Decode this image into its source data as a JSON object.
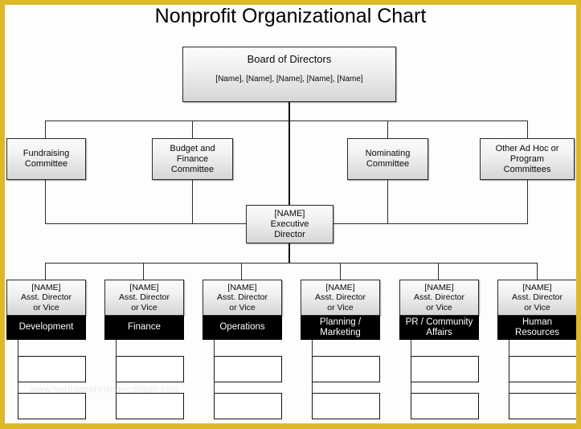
{
  "page": {
    "title": "Nonprofit Organizational Chart",
    "watermark": "www.heritagechristiancollege.com",
    "frame_color": "#ddb92a",
    "canvas_background": "#fdfdfc",
    "accent_dark": "#000000"
  },
  "board": {
    "title": "Board of Directors",
    "members": "[Name], [Name], [Name], [Name], [Name]"
  },
  "committees": [
    {
      "label": "Fundraising\nCommittee",
      "line1": "Fundraising",
      "line2": "Committee",
      "line3": ""
    },
    {
      "label": "Budget and Finance Committee",
      "line1": "Budget and",
      "line2": "Finance",
      "line3": "Committee"
    },
    {
      "label": "Nominating Committee",
      "line1": "Nominating",
      "line2": "Committee",
      "line3": ""
    },
    {
      "label": "Other Ad Hoc or Program Committees",
      "line1": "Other Ad Hoc or",
      "line2": "Program",
      "line3": "Committees"
    }
  ],
  "executive": {
    "name_placeholder": "[NAME]",
    "line1": "Executive",
    "line2": "Director"
  },
  "departments": [
    {
      "name_placeholder": "[NAME]",
      "role_line1": "Asst. Director",
      "role_line2": "or Vice",
      "dept_line1": "Development",
      "dept_line2": "",
      "subunits": 2
    },
    {
      "name_placeholder": "[NAME]",
      "role_line1": "Asst. Director",
      "role_line2": "or Vice",
      "dept_line1": "Finance",
      "dept_line2": "",
      "subunits": 2
    },
    {
      "name_placeholder": "[NAME]",
      "role_line1": "Asst. Director",
      "role_line2": "or Vice",
      "dept_line1": "Operations",
      "dept_line2": "",
      "subunits": 2
    },
    {
      "name_placeholder": "[NAME]",
      "role_line1": "Asst. Director",
      "role_line2": "or Vice",
      "dept_line1": "Planning /",
      "dept_line2": "Marketing",
      "subunits": 2
    },
    {
      "name_placeholder": "[NAME]",
      "role_line1": "Asst. Director",
      "role_line2": "or Vice",
      "dept_line1": "PR / Community",
      "dept_line2": "Affairs",
      "subunits": 2
    },
    {
      "name_placeholder": "[NAME]",
      "role_line1": "Asst. Director",
      "role_line2": "or Vice",
      "dept_line1": "Human",
      "dept_line2": "Resources",
      "subunits": 2
    }
  ]
}
